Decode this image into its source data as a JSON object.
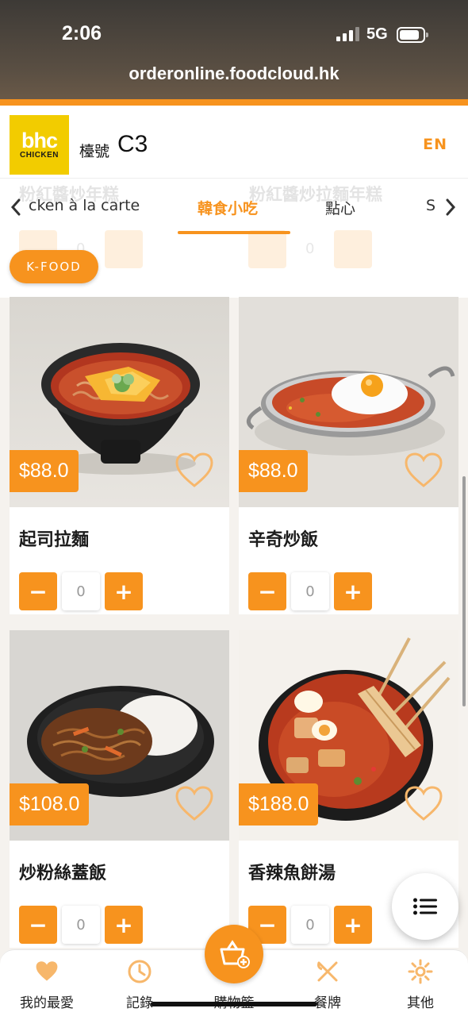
{
  "status_bar": {
    "time": "2:06",
    "network": "5G"
  },
  "browser": {
    "url": "orderonline.foodcloud.hk"
  },
  "header": {
    "logo_line1": "bhc",
    "logo_line2": "CHICKEN",
    "table_label": "檯號",
    "table_number": "C3",
    "language_toggle": "EN"
  },
  "background_ghost": {
    "item_left": "粉紅醬炒年糕",
    "item_right": "粉紅醬炒拉麵年糕",
    "qty": "0"
  },
  "tabs": {
    "items": [
      {
        "label": "cken à la carte",
        "active": false
      },
      {
        "label": "韓食小吃",
        "active": true
      },
      {
        "label": "點心",
        "active": false
      },
      {
        "label": "S",
        "active": false
      }
    ]
  },
  "category_chip": "K-FOOD",
  "products": [
    {
      "name": "起司拉麵",
      "price": "$88.0",
      "qty": "0"
    },
    {
      "name": "辛奇炒飯",
      "price": "$88.0",
      "qty": "0"
    },
    {
      "name": "炒粉絲蓋飯",
      "price": "$108.0",
      "qty": "0"
    },
    {
      "name": "香辣魚餅湯",
      "price": "$188.0",
      "qty": "0"
    }
  ],
  "stepper": {
    "minus": "−",
    "plus": "+"
  },
  "bottom_nav": {
    "favorites": "我的最愛",
    "history": "記錄",
    "cart": "購物籃",
    "menu": "餐牌",
    "more": "其他"
  },
  "colors": {
    "accent": "#f7931e",
    "logo_bg": "#f2cc00"
  }
}
